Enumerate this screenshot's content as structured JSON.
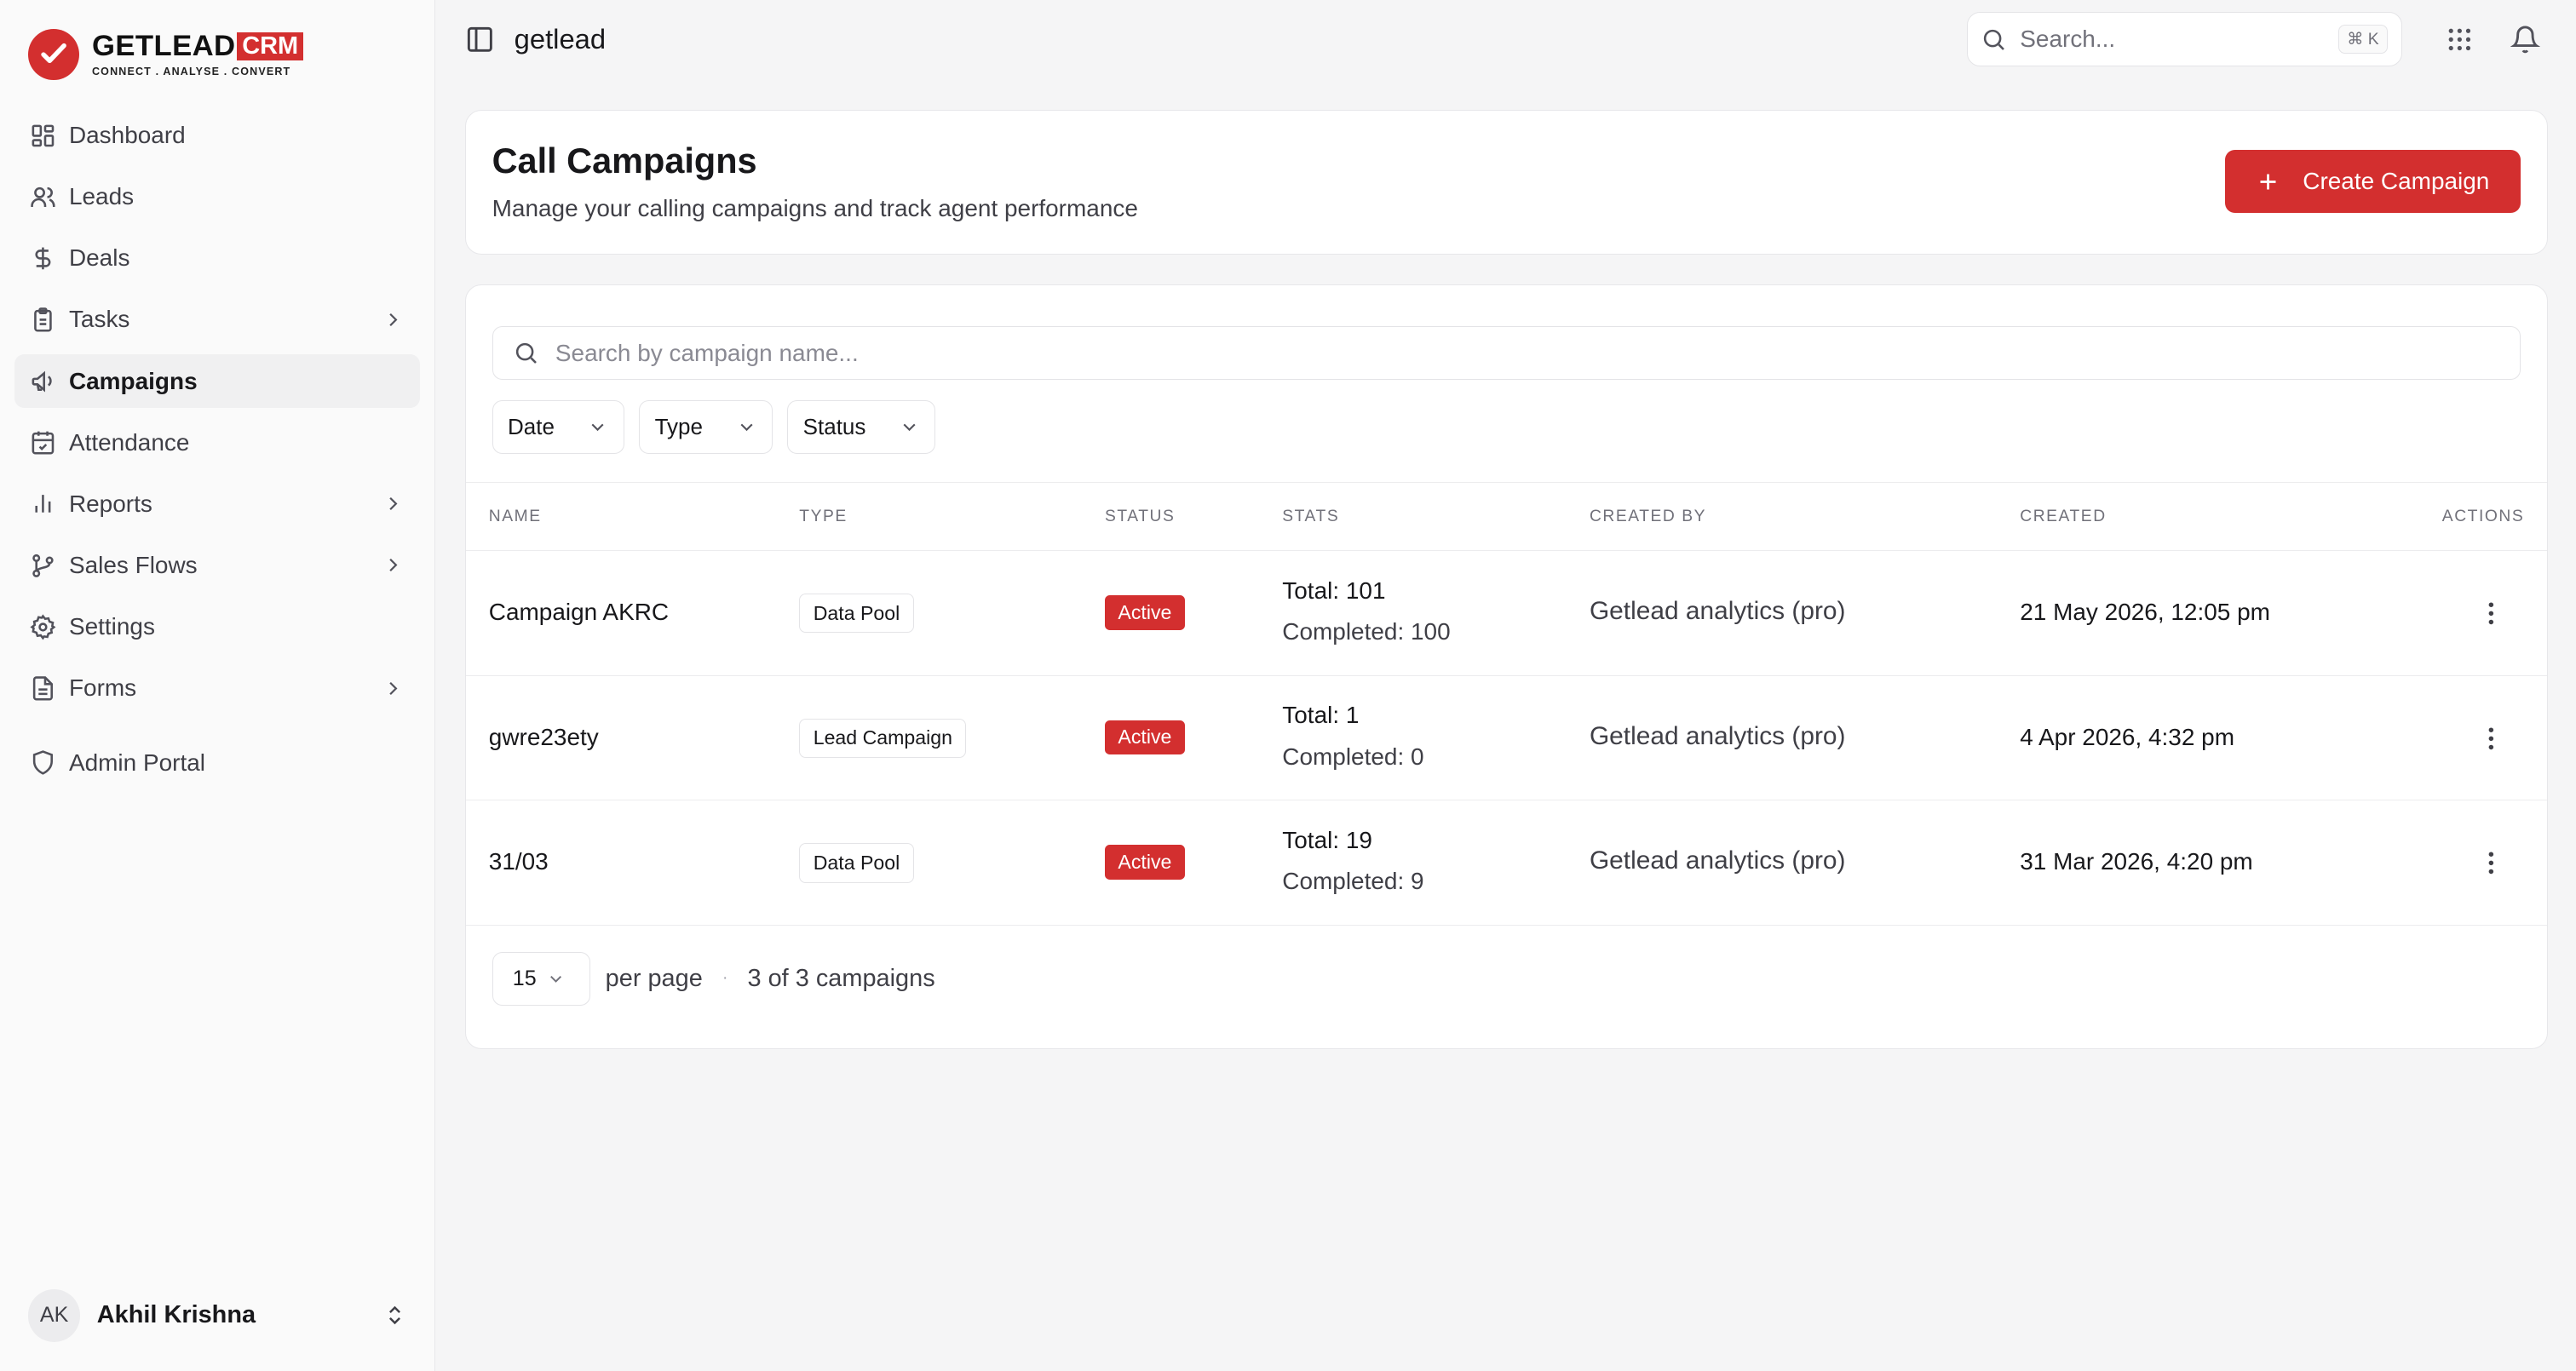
{
  "brand": {
    "word": "GETLEAD",
    "crm": "CRM",
    "tagline": "CONNECT . ANALYSE . CONVERT"
  },
  "sidebar": {
    "items": [
      {
        "label": "Dashboard",
        "icon": "dashboard-icon"
      },
      {
        "label": "Leads",
        "icon": "users-icon"
      },
      {
        "label": "Deals",
        "icon": "dollar-icon"
      },
      {
        "label": "Tasks",
        "icon": "clipboard-icon",
        "expandable": true
      },
      {
        "label": "Campaigns",
        "icon": "megaphone-icon",
        "active": true
      },
      {
        "label": "Attendance",
        "icon": "calendar-check-icon"
      },
      {
        "label": "Reports",
        "icon": "bar-chart-icon",
        "expandable": true
      },
      {
        "label": "Sales Flows",
        "icon": "git-branch-icon",
        "expandable": true
      },
      {
        "label": "Settings",
        "icon": "gear-icon"
      },
      {
        "label": "Forms",
        "icon": "file-icon",
        "expandable": true
      },
      {
        "label": "Admin Portal",
        "icon": "shield-icon"
      }
    ],
    "user": {
      "initials": "AK",
      "name": "Akhil Krishna"
    }
  },
  "topbar": {
    "org": "getlead",
    "search_placeholder": "Search...",
    "shortcut": "⌘ K"
  },
  "page": {
    "title": "Call Campaigns",
    "subtitle": "Manage your calling campaigns and track agent performance",
    "create_label": "Create Campaign"
  },
  "list": {
    "search_placeholder": "Search by campaign name...",
    "filters": [
      "Date",
      "Type",
      "Status"
    ],
    "columns": {
      "name": "NAME",
      "type": "TYPE",
      "status": "STATUS",
      "stats": "STATS",
      "created_by": "CREATED BY",
      "created": "CREATED",
      "actions": "ACTIONS"
    },
    "rows": [
      {
        "name": "Campaign AKRC",
        "type": "Data Pool",
        "status": "Active",
        "total": "Total: 101",
        "completed": "Completed: 100",
        "created_by": "Getlead analytics (pro)",
        "created": "21 May 2026, 12:05 pm"
      },
      {
        "name": "gwre23ety",
        "type": "Lead Campaign",
        "status": "Active",
        "total": "Total: 1",
        "completed": "Completed: 0",
        "created_by": "Getlead analytics (pro)",
        "created": "4 Apr 2026, 4:32 pm"
      },
      {
        "name": "31/03",
        "type": "Data Pool",
        "status": "Active",
        "total": "Total: 19",
        "completed": "Completed: 9",
        "created_by": "Getlead analytics (pro)",
        "created": "31 Mar 2026, 4:20 pm"
      }
    ],
    "pagination": {
      "per_page_value": "15",
      "per_page_label": "per page",
      "separator": "·",
      "count": "3 of 3 campaigns"
    }
  },
  "colors": {
    "accent": "#d32f2f",
    "sidebar_bg": "#fafafa",
    "page_bg": "#f5f5f6"
  }
}
